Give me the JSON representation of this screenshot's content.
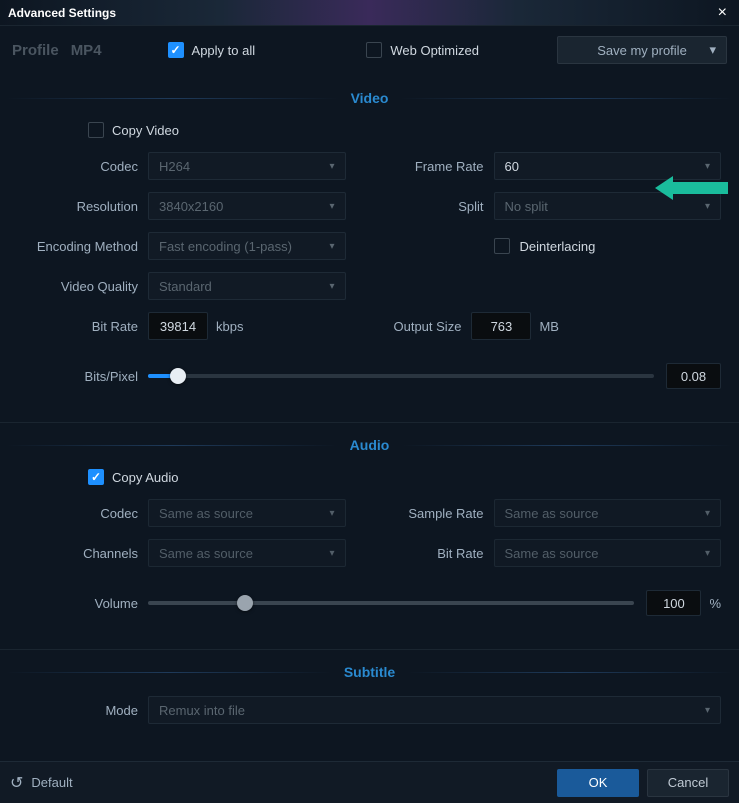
{
  "title": "Advanced Settings",
  "profile": {
    "label": "Profile",
    "value": "MP4"
  },
  "apply_to_all": "Apply to all",
  "web_optimized": "Web Optimized",
  "save_profile": "Save my profile",
  "sections": {
    "video": "Video",
    "audio": "Audio",
    "subtitle": "Subtitle"
  },
  "video": {
    "copy": "Copy Video",
    "codec_label": "Codec",
    "codec": "H264",
    "resolution_label": "Resolution",
    "resolution": "3840x2160",
    "encoding_label": "Encoding Method",
    "encoding": "Fast encoding (1-pass)",
    "quality_label": "Video Quality",
    "quality": "Standard",
    "bitrate_label": "Bit Rate",
    "bitrate": "39814",
    "bitrate_unit": "kbps",
    "framerate_label": "Frame Rate",
    "framerate": "60",
    "split_label": "Split",
    "split": "No split",
    "deinterlacing": "Deinterlacing",
    "output_label": "Output Size",
    "output": "763",
    "output_unit": "MB",
    "bpp_label": "Bits/Pixel",
    "bpp_value": "0.08"
  },
  "audio": {
    "copy": "Copy Audio",
    "codec_label": "Codec",
    "codec": "Same as source",
    "channels_label": "Channels",
    "channels": "Same as source",
    "samplerate_label": "Sample Rate",
    "samplerate": "Same as source",
    "bitrate_label": "Bit Rate",
    "bitrate": "Same as source",
    "volume_label": "Volume",
    "volume_value": "100",
    "volume_unit": "%"
  },
  "subtitle": {
    "mode_label": "Mode",
    "mode": "Remux into file"
  },
  "footer": {
    "default": "Default",
    "ok": "OK",
    "cancel": "Cancel"
  }
}
